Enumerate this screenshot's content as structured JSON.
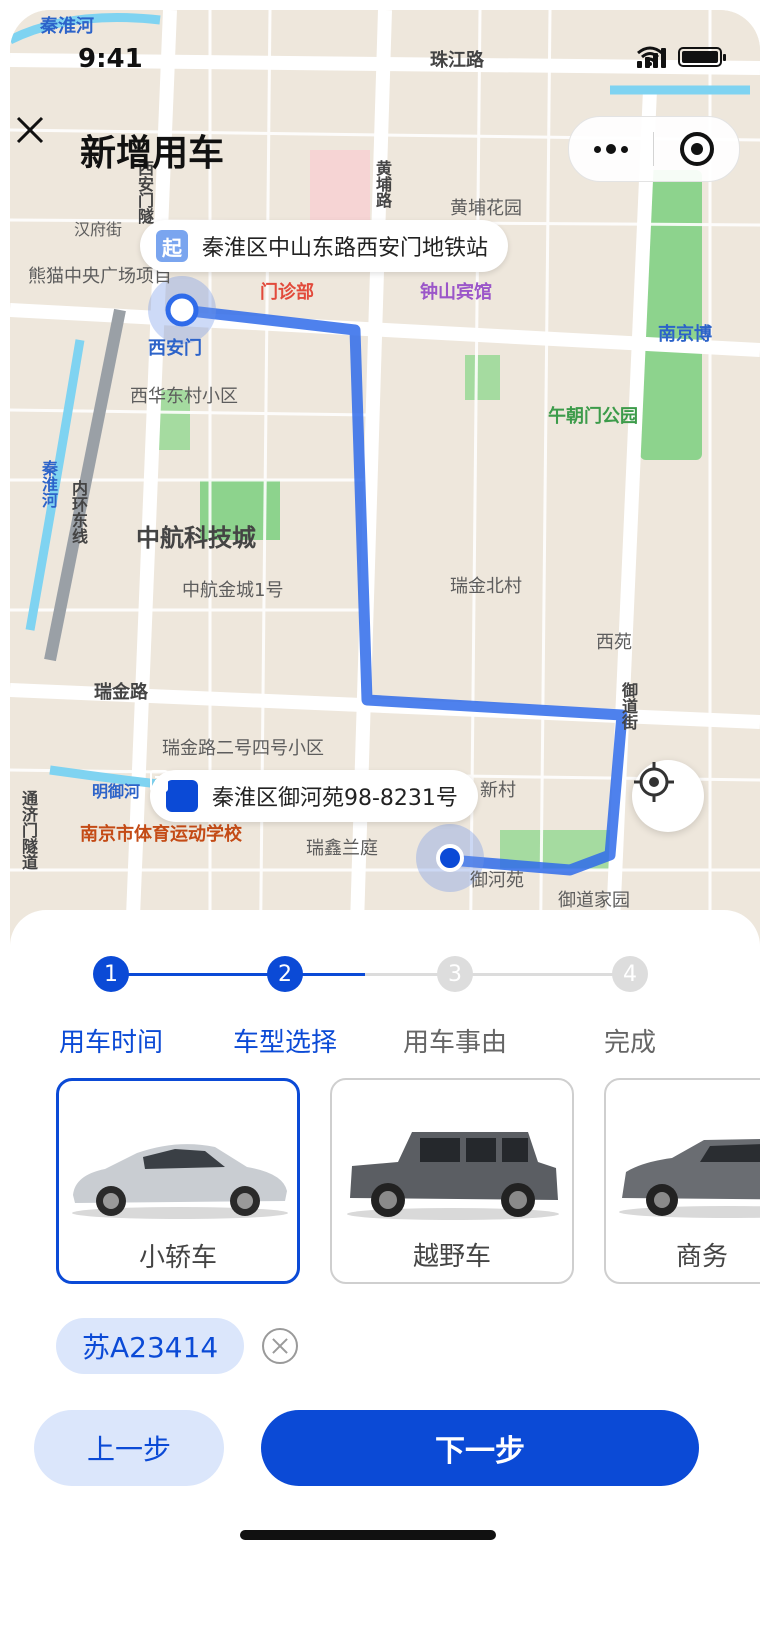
{
  "status_bar": {
    "time": "9:41"
  },
  "header": {
    "title": "新增用车",
    "close_icon": "close-icon",
    "more_icon": "more-dots-icon",
    "target_icon": "record-icon"
  },
  "map": {
    "start_tag": "起",
    "start_address": "秦淮区中山东路西安门地铁站",
    "end_address": "秦淮区御河苑98-8231号",
    "labels": {
      "zhujiang_road": "珠江路",
      "qinhuai_river_top": "秦淮河",
      "huangpu_garden": "黄埔花园",
      "xianmen_tunnel": "西安门隧",
      "huangpu_road": "黄埔路",
      "hanfu_street": "汉府街",
      "panda_plaza": "熊猫中央广场项目",
      "clinic": "门诊部",
      "zhongshan_hotel": "钟山宾馆",
      "nanjing_museum": "南京博",
      "xianmen_station": "西安门",
      "xihua_village": "西华东村小区",
      "wuchaomen_park": "午朝门公园",
      "qinhuai_river_left": "秦淮河",
      "inner_ring": "内环东线",
      "aviation_city": "中航科技城",
      "aviation_jincheng": "中航金城1号",
      "ruijin_north": "瑞金北村",
      "xiyuan": "西苑",
      "ruijin_road": "瑞金路",
      "ruijin_246": "瑞金路二号四号小区",
      "minghu_river": "明御河",
      "sports_school": "南京市体育运动学校",
      "ruixin_court": "瑞鑫兰庭",
      "tongji_tunnel": "通济门隧道",
      "yuhe_yuan": "御河苑",
      "yudao_garden": "御道家园",
      "new_village": "新村",
      "yudao_street": "御道街"
    }
  },
  "steps": [
    {
      "num": "1",
      "label": "用车时间",
      "state": "done"
    },
    {
      "num": "2",
      "label": "车型选择",
      "state": "active"
    },
    {
      "num": "3",
      "label": "用车事由",
      "state": "pending"
    },
    {
      "num": "4",
      "label": "完成",
      "state": "pending"
    }
  ],
  "vehicles": [
    {
      "name": "小轿车",
      "selected": true
    },
    {
      "name": "越野车",
      "selected": false
    },
    {
      "name": "商务",
      "selected": false
    }
  ],
  "plate": {
    "value": "苏A23414"
  },
  "actions": {
    "prev": "上一步",
    "next": "下一步"
  },
  "colors": {
    "primary": "#0b4ad6",
    "light_primary": "#dbe6fb",
    "route": "#2f6bea"
  }
}
